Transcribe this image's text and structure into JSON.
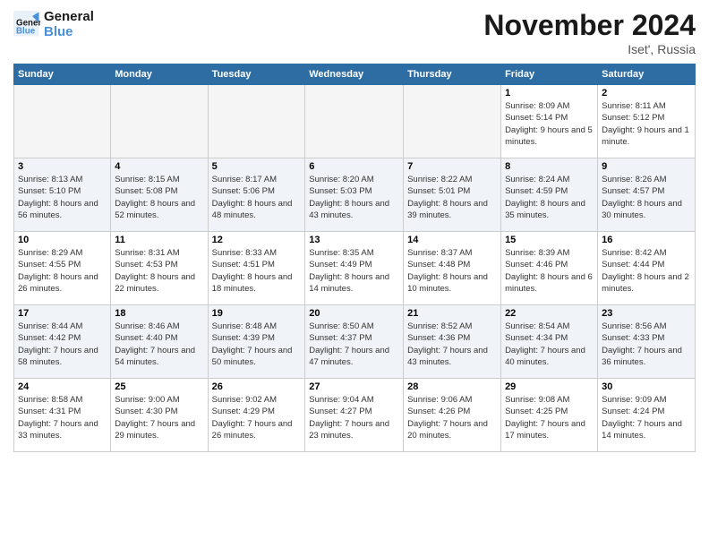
{
  "logo": {
    "line1": "General",
    "line2": "Blue"
  },
  "title": "November 2024",
  "location": "Iset', Russia",
  "days_of_week": [
    "Sunday",
    "Monday",
    "Tuesday",
    "Wednesday",
    "Thursday",
    "Friday",
    "Saturday"
  ],
  "weeks": [
    [
      {
        "day": "",
        "empty": true
      },
      {
        "day": "",
        "empty": true
      },
      {
        "day": "",
        "empty": true
      },
      {
        "day": "",
        "empty": true
      },
      {
        "day": "",
        "empty": true
      },
      {
        "day": "1",
        "sunrise": "8:09 AM",
        "sunset": "5:14 PM",
        "daylight": "9 hours and 5 minutes."
      },
      {
        "day": "2",
        "sunrise": "8:11 AM",
        "sunset": "5:12 PM",
        "daylight": "9 hours and 1 minute."
      }
    ],
    [
      {
        "day": "3",
        "sunrise": "8:13 AM",
        "sunset": "5:10 PM",
        "daylight": "8 hours and 56 minutes."
      },
      {
        "day": "4",
        "sunrise": "8:15 AM",
        "sunset": "5:08 PM",
        "daylight": "8 hours and 52 minutes."
      },
      {
        "day": "5",
        "sunrise": "8:17 AM",
        "sunset": "5:06 PM",
        "daylight": "8 hours and 48 minutes."
      },
      {
        "day": "6",
        "sunrise": "8:20 AM",
        "sunset": "5:03 PM",
        "daylight": "8 hours and 43 minutes."
      },
      {
        "day": "7",
        "sunrise": "8:22 AM",
        "sunset": "5:01 PM",
        "daylight": "8 hours and 39 minutes."
      },
      {
        "day": "8",
        "sunrise": "8:24 AM",
        "sunset": "4:59 PM",
        "daylight": "8 hours and 35 minutes."
      },
      {
        "day": "9",
        "sunrise": "8:26 AM",
        "sunset": "4:57 PM",
        "daylight": "8 hours and 30 minutes."
      }
    ],
    [
      {
        "day": "10",
        "sunrise": "8:29 AM",
        "sunset": "4:55 PM",
        "daylight": "8 hours and 26 minutes."
      },
      {
        "day": "11",
        "sunrise": "8:31 AM",
        "sunset": "4:53 PM",
        "daylight": "8 hours and 22 minutes."
      },
      {
        "day": "12",
        "sunrise": "8:33 AM",
        "sunset": "4:51 PM",
        "daylight": "8 hours and 18 minutes."
      },
      {
        "day": "13",
        "sunrise": "8:35 AM",
        "sunset": "4:49 PM",
        "daylight": "8 hours and 14 minutes."
      },
      {
        "day": "14",
        "sunrise": "8:37 AM",
        "sunset": "4:48 PM",
        "daylight": "8 hours and 10 minutes."
      },
      {
        "day": "15",
        "sunrise": "8:39 AM",
        "sunset": "4:46 PM",
        "daylight": "8 hours and 6 minutes."
      },
      {
        "day": "16",
        "sunrise": "8:42 AM",
        "sunset": "4:44 PM",
        "daylight": "8 hours and 2 minutes."
      }
    ],
    [
      {
        "day": "17",
        "sunrise": "8:44 AM",
        "sunset": "4:42 PM",
        "daylight": "7 hours and 58 minutes."
      },
      {
        "day": "18",
        "sunrise": "8:46 AM",
        "sunset": "4:40 PM",
        "daylight": "7 hours and 54 minutes."
      },
      {
        "day": "19",
        "sunrise": "8:48 AM",
        "sunset": "4:39 PM",
        "daylight": "7 hours and 50 minutes."
      },
      {
        "day": "20",
        "sunrise": "8:50 AM",
        "sunset": "4:37 PM",
        "daylight": "7 hours and 47 minutes."
      },
      {
        "day": "21",
        "sunrise": "8:52 AM",
        "sunset": "4:36 PM",
        "daylight": "7 hours and 43 minutes."
      },
      {
        "day": "22",
        "sunrise": "8:54 AM",
        "sunset": "4:34 PM",
        "daylight": "7 hours and 40 minutes."
      },
      {
        "day": "23",
        "sunrise": "8:56 AM",
        "sunset": "4:33 PM",
        "daylight": "7 hours and 36 minutes."
      }
    ],
    [
      {
        "day": "24",
        "sunrise": "8:58 AM",
        "sunset": "4:31 PM",
        "daylight": "7 hours and 33 minutes."
      },
      {
        "day": "25",
        "sunrise": "9:00 AM",
        "sunset": "4:30 PM",
        "daylight": "7 hours and 29 minutes."
      },
      {
        "day": "26",
        "sunrise": "9:02 AM",
        "sunset": "4:29 PM",
        "daylight": "7 hours and 26 minutes."
      },
      {
        "day": "27",
        "sunrise": "9:04 AM",
        "sunset": "4:27 PM",
        "daylight": "7 hours and 23 minutes."
      },
      {
        "day": "28",
        "sunrise": "9:06 AM",
        "sunset": "4:26 PM",
        "daylight": "7 hours and 20 minutes."
      },
      {
        "day": "29",
        "sunrise": "9:08 AM",
        "sunset": "4:25 PM",
        "daylight": "7 hours and 17 minutes."
      },
      {
        "day": "30",
        "sunrise": "9:09 AM",
        "sunset": "4:24 PM",
        "daylight": "7 hours and 14 minutes."
      }
    ]
  ],
  "labels": {
    "sunrise": "Sunrise:",
    "sunset": "Sunset:",
    "daylight": "Daylight:"
  }
}
